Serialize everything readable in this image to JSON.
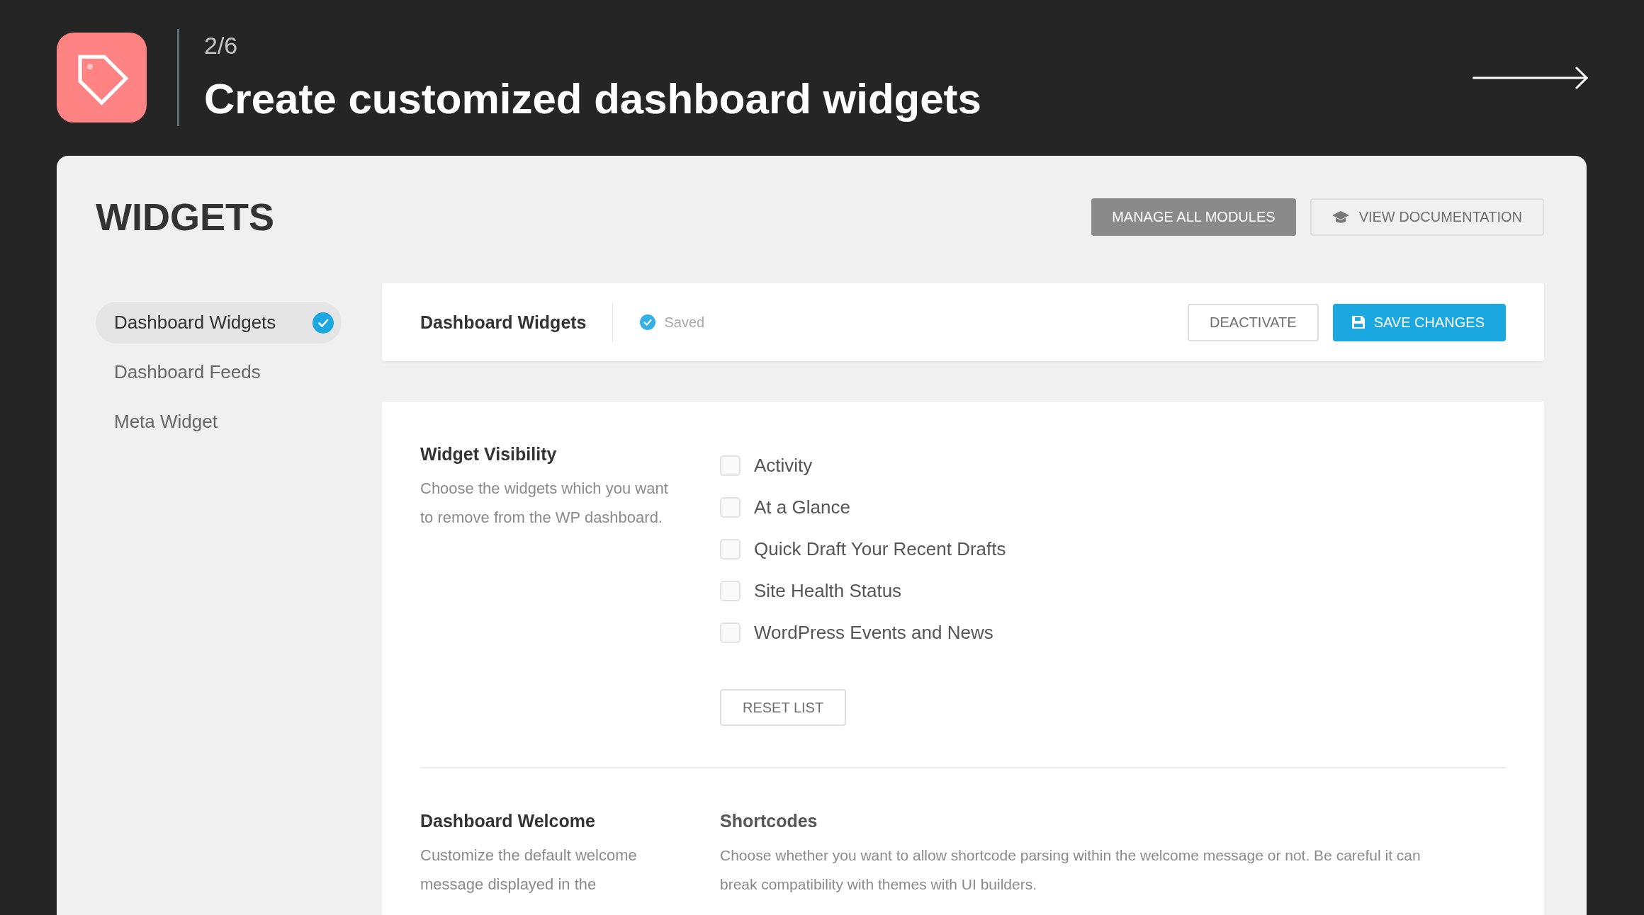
{
  "header": {
    "step": "2/6",
    "title": "Create customized dashboard widgets"
  },
  "page": {
    "title": "WIDGETS",
    "buttons": [
      {
        "label": "MANAGE ALL MODULES",
        "kind": "muted"
      },
      {
        "label": "VIEW DOCUMENTATION",
        "kind": "docs"
      }
    ]
  },
  "sidebar": {
    "items": [
      {
        "label": "Dashboard Widgets",
        "selected": true,
        "active": true
      },
      {
        "label": "Dashboard Feeds",
        "selected": false,
        "active": false
      },
      {
        "label": "Meta Widget",
        "selected": false,
        "active": false
      }
    ]
  },
  "module_bar": {
    "title": "Dashboard Widgets",
    "status": "Saved",
    "buttons": [
      {
        "label": "DEACTIVATE",
        "kind": "outline"
      },
      {
        "label": "SAVE CHANGES",
        "kind": "save"
      }
    ]
  },
  "settings": [
    {
      "kind": "checklist",
      "title": "Widget Visibility",
      "description": "Choose the widgets which you want to remove from the WP dashboard.",
      "options": [
        {
          "label": "Activity",
          "checked": false
        },
        {
          "label": "At a Glance",
          "checked": false
        },
        {
          "label": "Quick Draft Your Recent Drafts",
          "checked": false
        },
        {
          "label": "Site Health Status",
          "checked": false
        },
        {
          "label": "WordPress Events and News",
          "checked": false
        }
      ],
      "button": {
        "label": "RESET LIST",
        "kind": "outline"
      }
    },
    {
      "kind": "nested",
      "title": "Dashboard Welcome",
      "description": "Customize the default welcome message displayed in the",
      "subsection": {
        "title": "Shortcodes",
        "description": "Choose whether you want to allow shortcode parsing within the welcome message or not. Be careful it can break compatibility with themes with UI builders."
      }
    }
  ]
}
